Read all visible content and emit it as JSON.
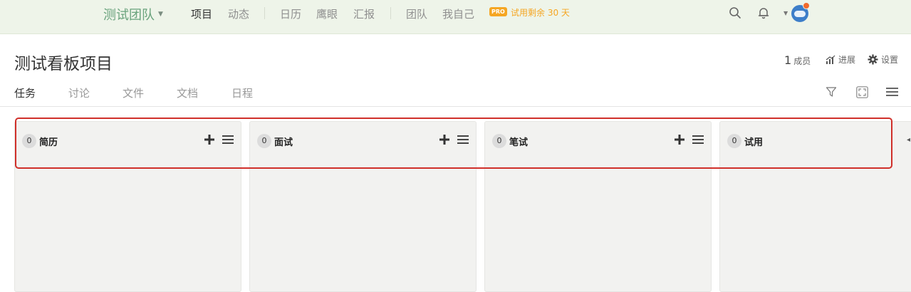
{
  "topnav": {
    "team_name": "测试团队",
    "links": [
      {
        "label": "项目",
        "active": true
      },
      {
        "label": "动态",
        "active": false
      },
      {
        "label": "日历",
        "active": false
      },
      {
        "label": "鹰眼",
        "active": false
      },
      {
        "label": "汇报",
        "active": false
      },
      {
        "label": "团队",
        "active": false
      },
      {
        "label": "我自己",
        "active": false
      }
    ],
    "pro_badge": "PRO",
    "trial_text": "试用剩余 30 天",
    "icons": [
      "search-icon",
      "bell-icon",
      "avatar"
    ]
  },
  "project": {
    "title": "测试看板项目",
    "members_count": "1",
    "members_label": "成员",
    "progress_label": "进展",
    "settings_label": "设置"
  },
  "tabs": [
    {
      "label": "任务",
      "active": true
    },
    {
      "label": "讨论",
      "active": false
    },
    {
      "label": "文件",
      "active": false
    },
    {
      "label": "文档",
      "active": false
    },
    {
      "label": "日程",
      "active": false
    }
  ],
  "board": {
    "columns": [
      {
        "count": "0",
        "name": "简历"
      },
      {
        "count": "0",
        "name": "面试"
      },
      {
        "count": "0",
        "name": "笔试"
      },
      {
        "count": "0",
        "name": "试用"
      }
    ]
  },
  "colors": {
    "topnav_bg": "#eef4e9",
    "team_green": "#6aa37d",
    "pro_orange": "#f5a623",
    "column_bg": "#f2f2f0",
    "highlight_red": "#d0302a"
  }
}
